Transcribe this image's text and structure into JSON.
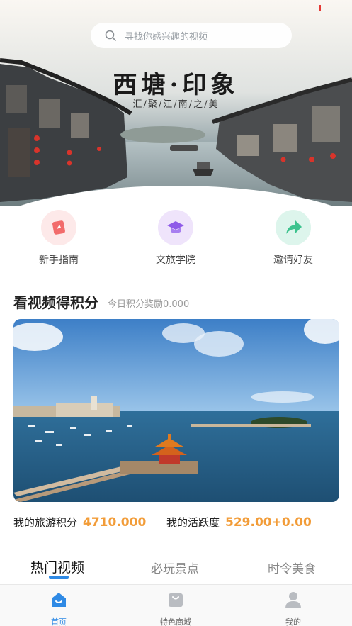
{
  "search": {
    "placeholder": "寻找你感兴趣的视频"
  },
  "banner": {
    "title": "西塘·印象",
    "subtitle": "汇/聚/江/南/之/美"
  },
  "quick_entries": [
    {
      "label": "新手指南",
      "icon": "guide-icon",
      "color": "#f26b6b"
    },
    {
      "label": "文旅学院",
      "icon": "graduation-cap-icon",
      "color": "#8f5be8"
    },
    {
      "label": "邀请好友",
      "icon": "share-arrow-icon",
      "color": "#3cc38e"
    }
  ],
  "section": {
    "title": "看视频得积分",
    "subtitle": "今日积分奖励0.000"
  },
  "points": {
    "travel_label": "我的旅游积分",
    "travel_value": "4710.000",
    "activity_label": "我的活跃度",
    "activity_value": "529.00+0.00"
  },
  "tabs": [
    {
      "label": "热门视频",
      "active": true
    },
    {
      "label": "必玩景点",
      "active": false
    },
    {
      "label": "时令美食",
      "active": false
    }
  ],
  "bottom_nav": [
    {
      "label": "首页",
      "icon": "home-icon",
      "active": true
    },
    {
      "label": "特色商城",
      "icon": "shopping-bag-icon",
      "active": false
    },
    {
      "label": "我的",
      "icon": "profile-icon",
      "active": false
    }
  ],
  "colors": {
    "accent": "#2f8ae5",
    "points": "#f29c38"
  }
}
